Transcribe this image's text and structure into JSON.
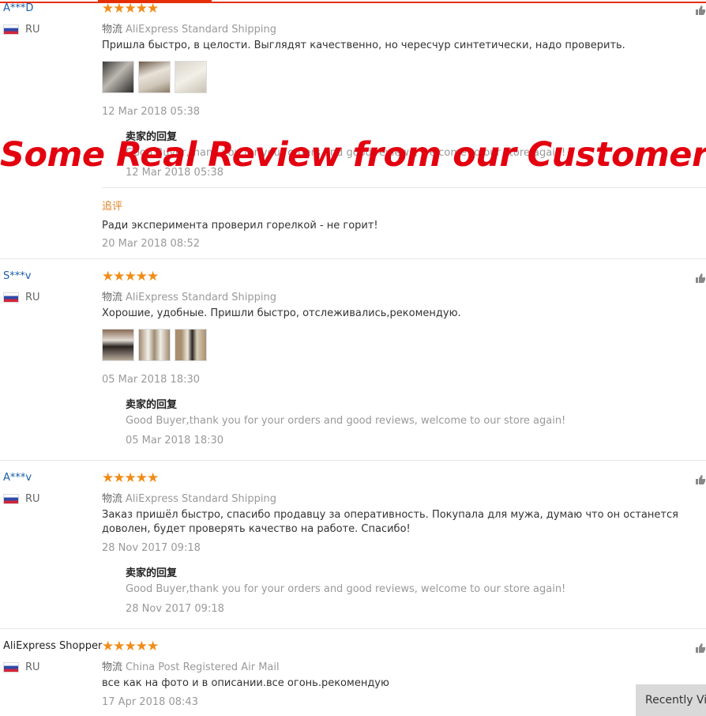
{
  "colors": {
    "accent": "#e62e04",
    "stars": "#f08c18",
    "banner": "#e3000f",
    "username": "#1a5ea8"
  },
  "banner_text": "Some Real Review from our Customers",
  "stars_glyph": "★★★★★",
  "recently_button": "Recently Vie",
  "reviews": [
    {
      "user": "A***D",
      "country": "RU",
      "shipping_tag": "物流",
      "shipping": "AliExpress Standard Shipping",
      "text": "Пришла быстро, в целости. Выглядят качественно, но чересчур синтетически, надо проверить.",
      "date": "12 Mar 2018 05:38",
      "reply_title": "卖家的回复",
      "reply_text": "Good Buyer,thank you for your orders and good reviews, welcome to our store again!",
      "reply_date": "12 Mar 2018 05:38",
      "followup_label": "追评",
      "followup_text": "Ради эксперимента проверил горелкой - не горит!",
      "followup_date": "20 Mar 2018 08:52"
    },
    {
      "user": "S***v",
      "country": "RU",
      "shipping_tag": "物流",
      "shipping": "AliExpress Standard Shipping",
      "text": "Хорошие, удобные. Пришли быстро, отслеживались,рекомендую.",
      "date": "05 Mar 2018 18:30",
      "reply_title": "卖家的回复",
      "reply_text": "Good Buyer,thank you for your orders and good reviews, welcome to our store again!",
      "reply_date": "05 Mar 2018 18:30"
    },
    {
      "user": "A***v",
      "country": "RU",
      "shipping_tag": "物流",
      "shipping": "AliExpress Standard Shipping",
      "text": "Заказ пришёл быстро, спасибо продавцу за оперативность. Покупала для мужа, думаю что он останется доволен, будет проверять качество на работе. Спасибо!",
      "date": "28 Nov 2017 09:18",
      "reply_title": "卖家的回复",
      "reply_text": "Good Buyer,thank you for your orders and good reviews, welcome to our store again!",
      "reply_date": "28 Nov 2017 09:18"
    },
    {
      "user": "AliExpress Shopper",
      "country": "RU",
      "shipping_tag": "物流",
      "shipping": "China Post Registered Air Mail",
      "text": "все как на фото и в описании.все огонь.рекомендую",
      "date": "17 Apr 2018 08:43"
    }
  ]
}
